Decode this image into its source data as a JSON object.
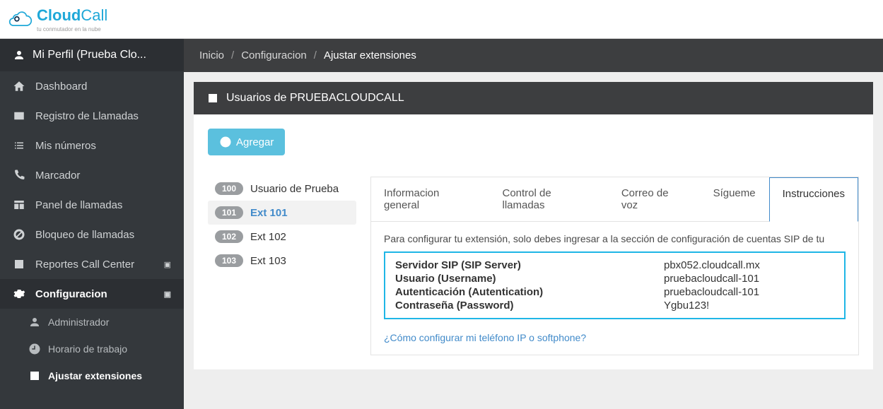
{
  "brand": {
    "name_a": "Cloud",
    "name_b": "Call",
    "tagline": "tu conmutador en la nube"
  },
  "profile": {
    "label": "Mi Perfil (Prueba Clo..."
  },
  "sidebar": {
    "items": [
      {
        "label": "Dashboard",
        "icon": "home"
      },
      {
        "label": "Registro de Llamadas",
        "icon": "list-card"
      },
      {
        "label": "Mis números",
        "icon": "list"
      },
      {
        "label": "Marcador",
        "icon": "phone"
      },
      {
        "label": "Panel de llamadas",
        "icon": "panel"
      },
      {
        "label": "Bloqueo de llamadas",
        "icon": "block"
      },
      {
        "label": "Reportes Call Center",
        "icon": "report",
        "expandable": true
      },
      {
        "label": "Configuracion",
        "icon": "gear",
        "expandable": true,
        "active": true
      }
    ],
    "subitems": [
      {
        "label": "Administrador",
        "icon": "user"
      },
      {
        "label": "Horario de trabajo",
        "icon": "clock"
      },
      {
        "label": "Ajustar extensiones",
        "icon": "phone-sq",
        "active": true
      }
    ]
  },
  "breadcrumb": {
    "a": "Inicio",
    "b": "Configuracion",
    "c": "Ajustar extensiones"
  },
  "panel": {
    "title": "Usuarios de PRUEBACLOUDCALL"
  },
  "add_button": "Agregar",
  "extensions": [
    {
      "num": "100",
      "label": "Usuario de Prueba"
    },
    {
      "num": "101",
      "label": "Ext 101",
      "selected": true
    },
    {
      "num": "102",
      "label": "Ext 102"
    },
    {
      "num": "103",
      "label": "Ext 103"
    }
  ],
  "tabs": [
    {
      "label": "Informacion general"
    },
    {
      "label": "Control de llamadas"
    },
    {
      "label": "Correo de voz"
    },
    {
      "label": "Sígueme"
    },
    {
      "label": "Instrucciones",
      "active": true
    }
  ],
  "instructions": {
    "intro": "Para configurar tu extensión, solo debes ingresar a la sección de configuración de cuentas SIP de tu",
    "rows": [
      {
        "k": "Servidor SIP (SIP Server)",
        "v": "pbx052.cloudcall.mx"
      },
      {
        "k": "Usuario (Username)",
        "v": "pruebacloudcall-101"
      },
      {
        "k": "Autenticación (Autentication)",
        "v": "pruebacloudcall-101"
      },
      {
        "k": "Contraseña (Password)",
        "v": "Ygbu123!"
      }
    ],
    "help": "¿Cómo configurar mi teléfono IP o softphone?"
  }
}
